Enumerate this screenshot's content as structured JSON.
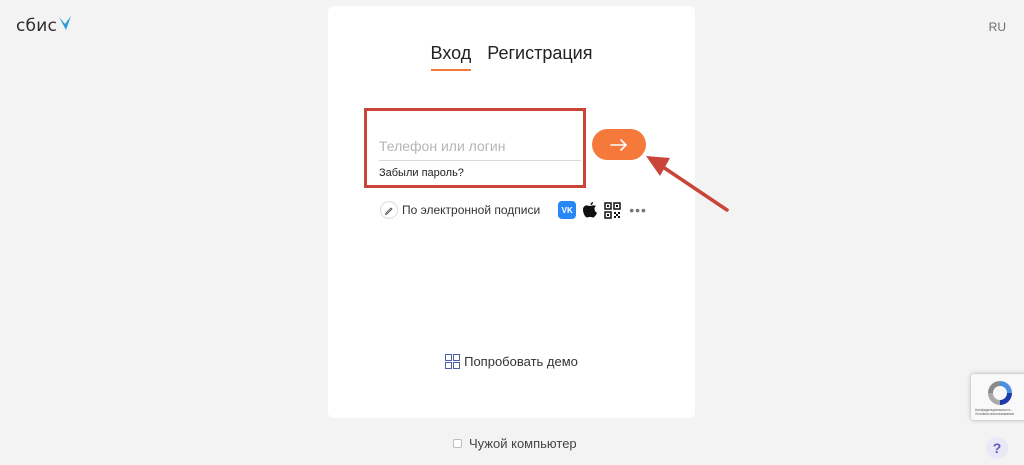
{
  "header": {
    "logo_text": "сбис",
    "language": "RU"
  },
  "login_card": {
    "tabs": [
      {
        "label": "Вход",
        "active": true
      },
      {
        "label": "Регистрация",
        "active": false
      }
    ],
    "login_field": {
      "placeholder": "Телефон или логин",
      "value": ""
    },
    "forgot_password": "Забыли пароль?",
    "submit_icon": "arrow-right-icon",
    "esign_label": "По электронной подписи",
    "esign_icon": "pen-icon",
    "social_icons": [
      "vk-icon",
      "apple-icon",
      "qr-code-icon",
      "more-icon"
    ],
    "vk_text": "VK",
    "more_text": "•••",
    "demo_label": "Попробовать демо",
    "demo_icon": "grid-icon"
  },
  "footer": {
    "foreign_computer_label": "Чужой компьютер",
    "foreign_computer_checked": false
  },
  "recaptcha": {
    "terms": "Конфиденциальность - Условия использования"
  },
  "help_button": "?",
  "colors": {
    "accent": "#f5793b",
    "highlight": "#c9453a",
    "logo_blue": "#2a9bd9",
    "vk_blue": "#2787f5"
  }
}
